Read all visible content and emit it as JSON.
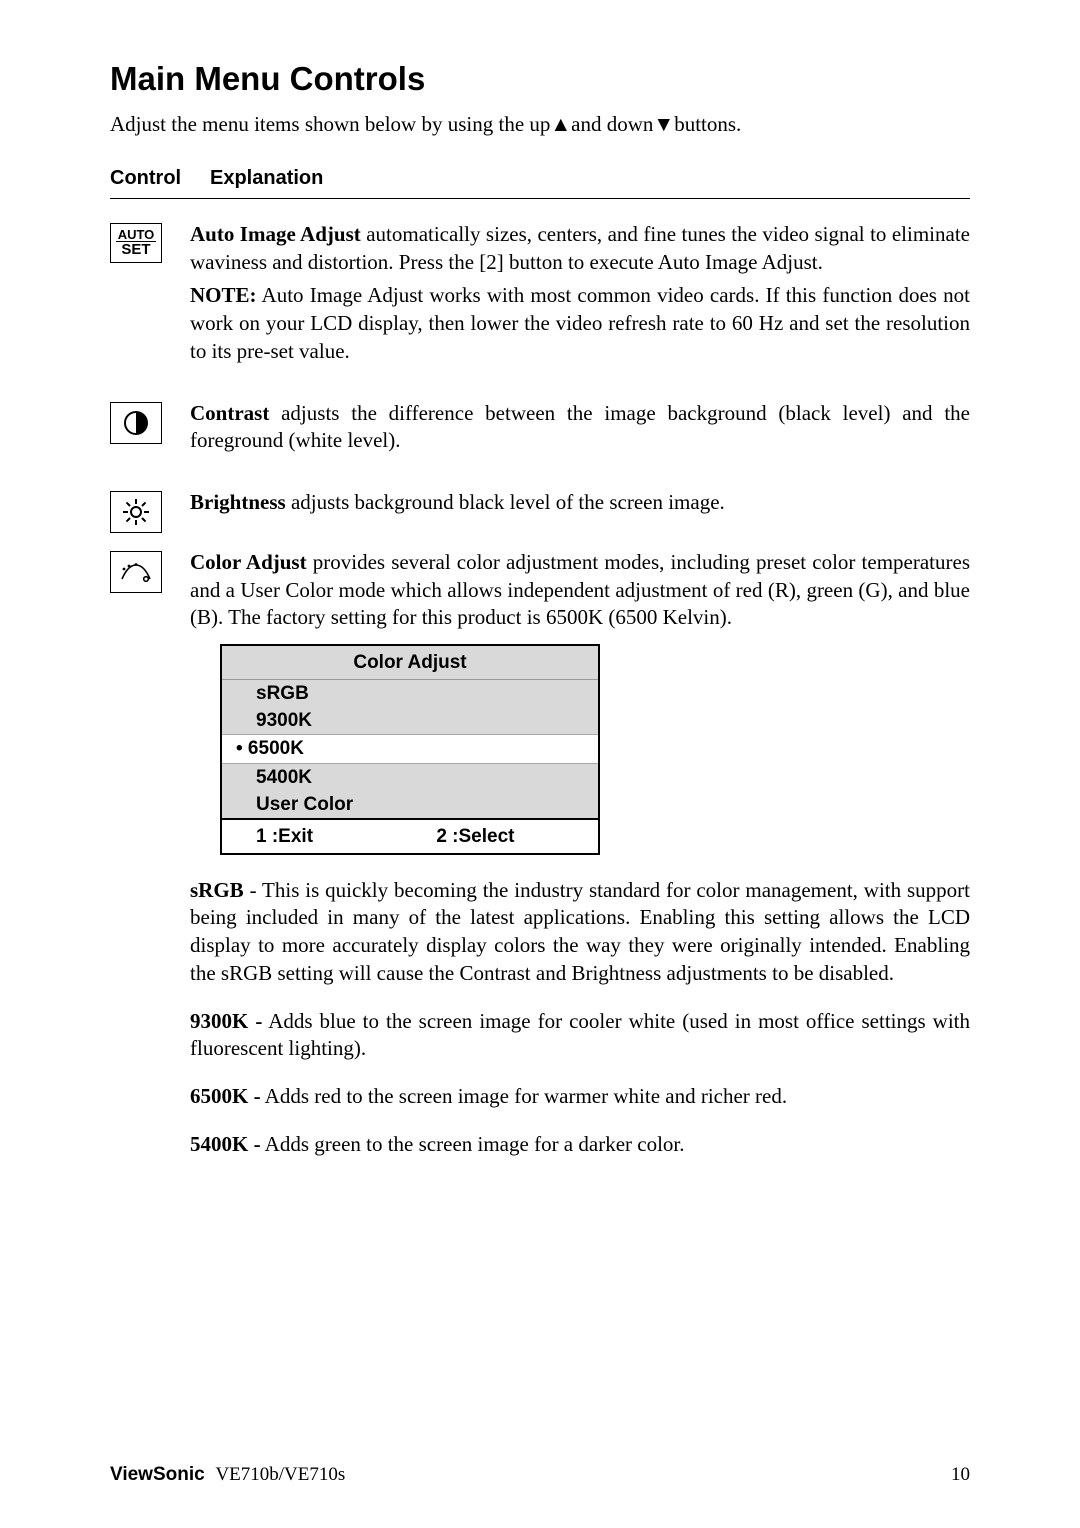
{
  "title": "Main Menu Controls",
  "intro": "Adjust the menu items shown below by using the up▲and down▼buttons.",
  "header": {
    "col1": "Control",
    "col2": "Explanation"
  },
  "autoset": {
    "icon_line1": "AUTO",
    "icon_line2": "SET",
    "p1_lead": "Auto Image Adjust",
    "p1_rest": " automatically sizes, centers, and fine tunes the video signal to eliminate waviness and distortion. Press the [2] button to execute Auto Image Adjust.",
    "note_lead": "NOTE:",
    "note_rest": " Auto Image Adjust works with most common video cards. If this function does not work on your LCD display, then lower the video refresh rate to 60 Hz and set the resolution to its pre-set value."
  },
  "contrast": {
    "lead": "Contrast",
    "rest": " adjusts the difference between the image background  (black level) and the foreground (white level)."
  },
  "brightness": {
    "lead": "Brightness",
    "rest": " adjusts background black level of the screen image."
  },
  "coloradjust": {
    "lead": "Color Adjust",
    "rest": " provides several color adjustment modes, including preset color temperatures and a User Color mode which allows independent adjustment of red (R), green (G), and blue (B). The factory setting for this product is 6500K (6500 Kelvin).",
    "menu": {
      "title": "Color Adjust",
      "items": {
        "srgb": "sRGB",
        "k9300": "9300K",
        "k6500": "• 6500K",
        "k5400": "5400K",
        "usercolor": "User Color"
      },
      "footer_left": "1 :Exit",
      "footer_right": "2 :Select"
    },
    "srgb_lead": "sRGB",
    "srgb_rest": " - This is quickly becoming the industry standard for color management, with support being included in many of the latest applications. Enabling this setting allows the LCD display to more accurately display colors the way they were originally intended. Enabling the sRGB setting will cause the Contrast and Brightness adjustments to be disabled.",
    "k9300_lead": "9300K -",
    "k9300_rest": " Adds blue to the screen image for cooler white (used in most office settings with fluorescent lighting).",
    "k6500_lead": "6500K -",
    "k6500_rest": " Adds red to the screen image for warmer white and richer red.",
    "k5400_lead": "5400K -",
    "k5400_rest": " Adds green to the screen image for a darker color."
  },
  "footer": {
    "brand": "ViewSonic",
    "model": "VE710b/VE710s",
    "page": "10"
  }
}
